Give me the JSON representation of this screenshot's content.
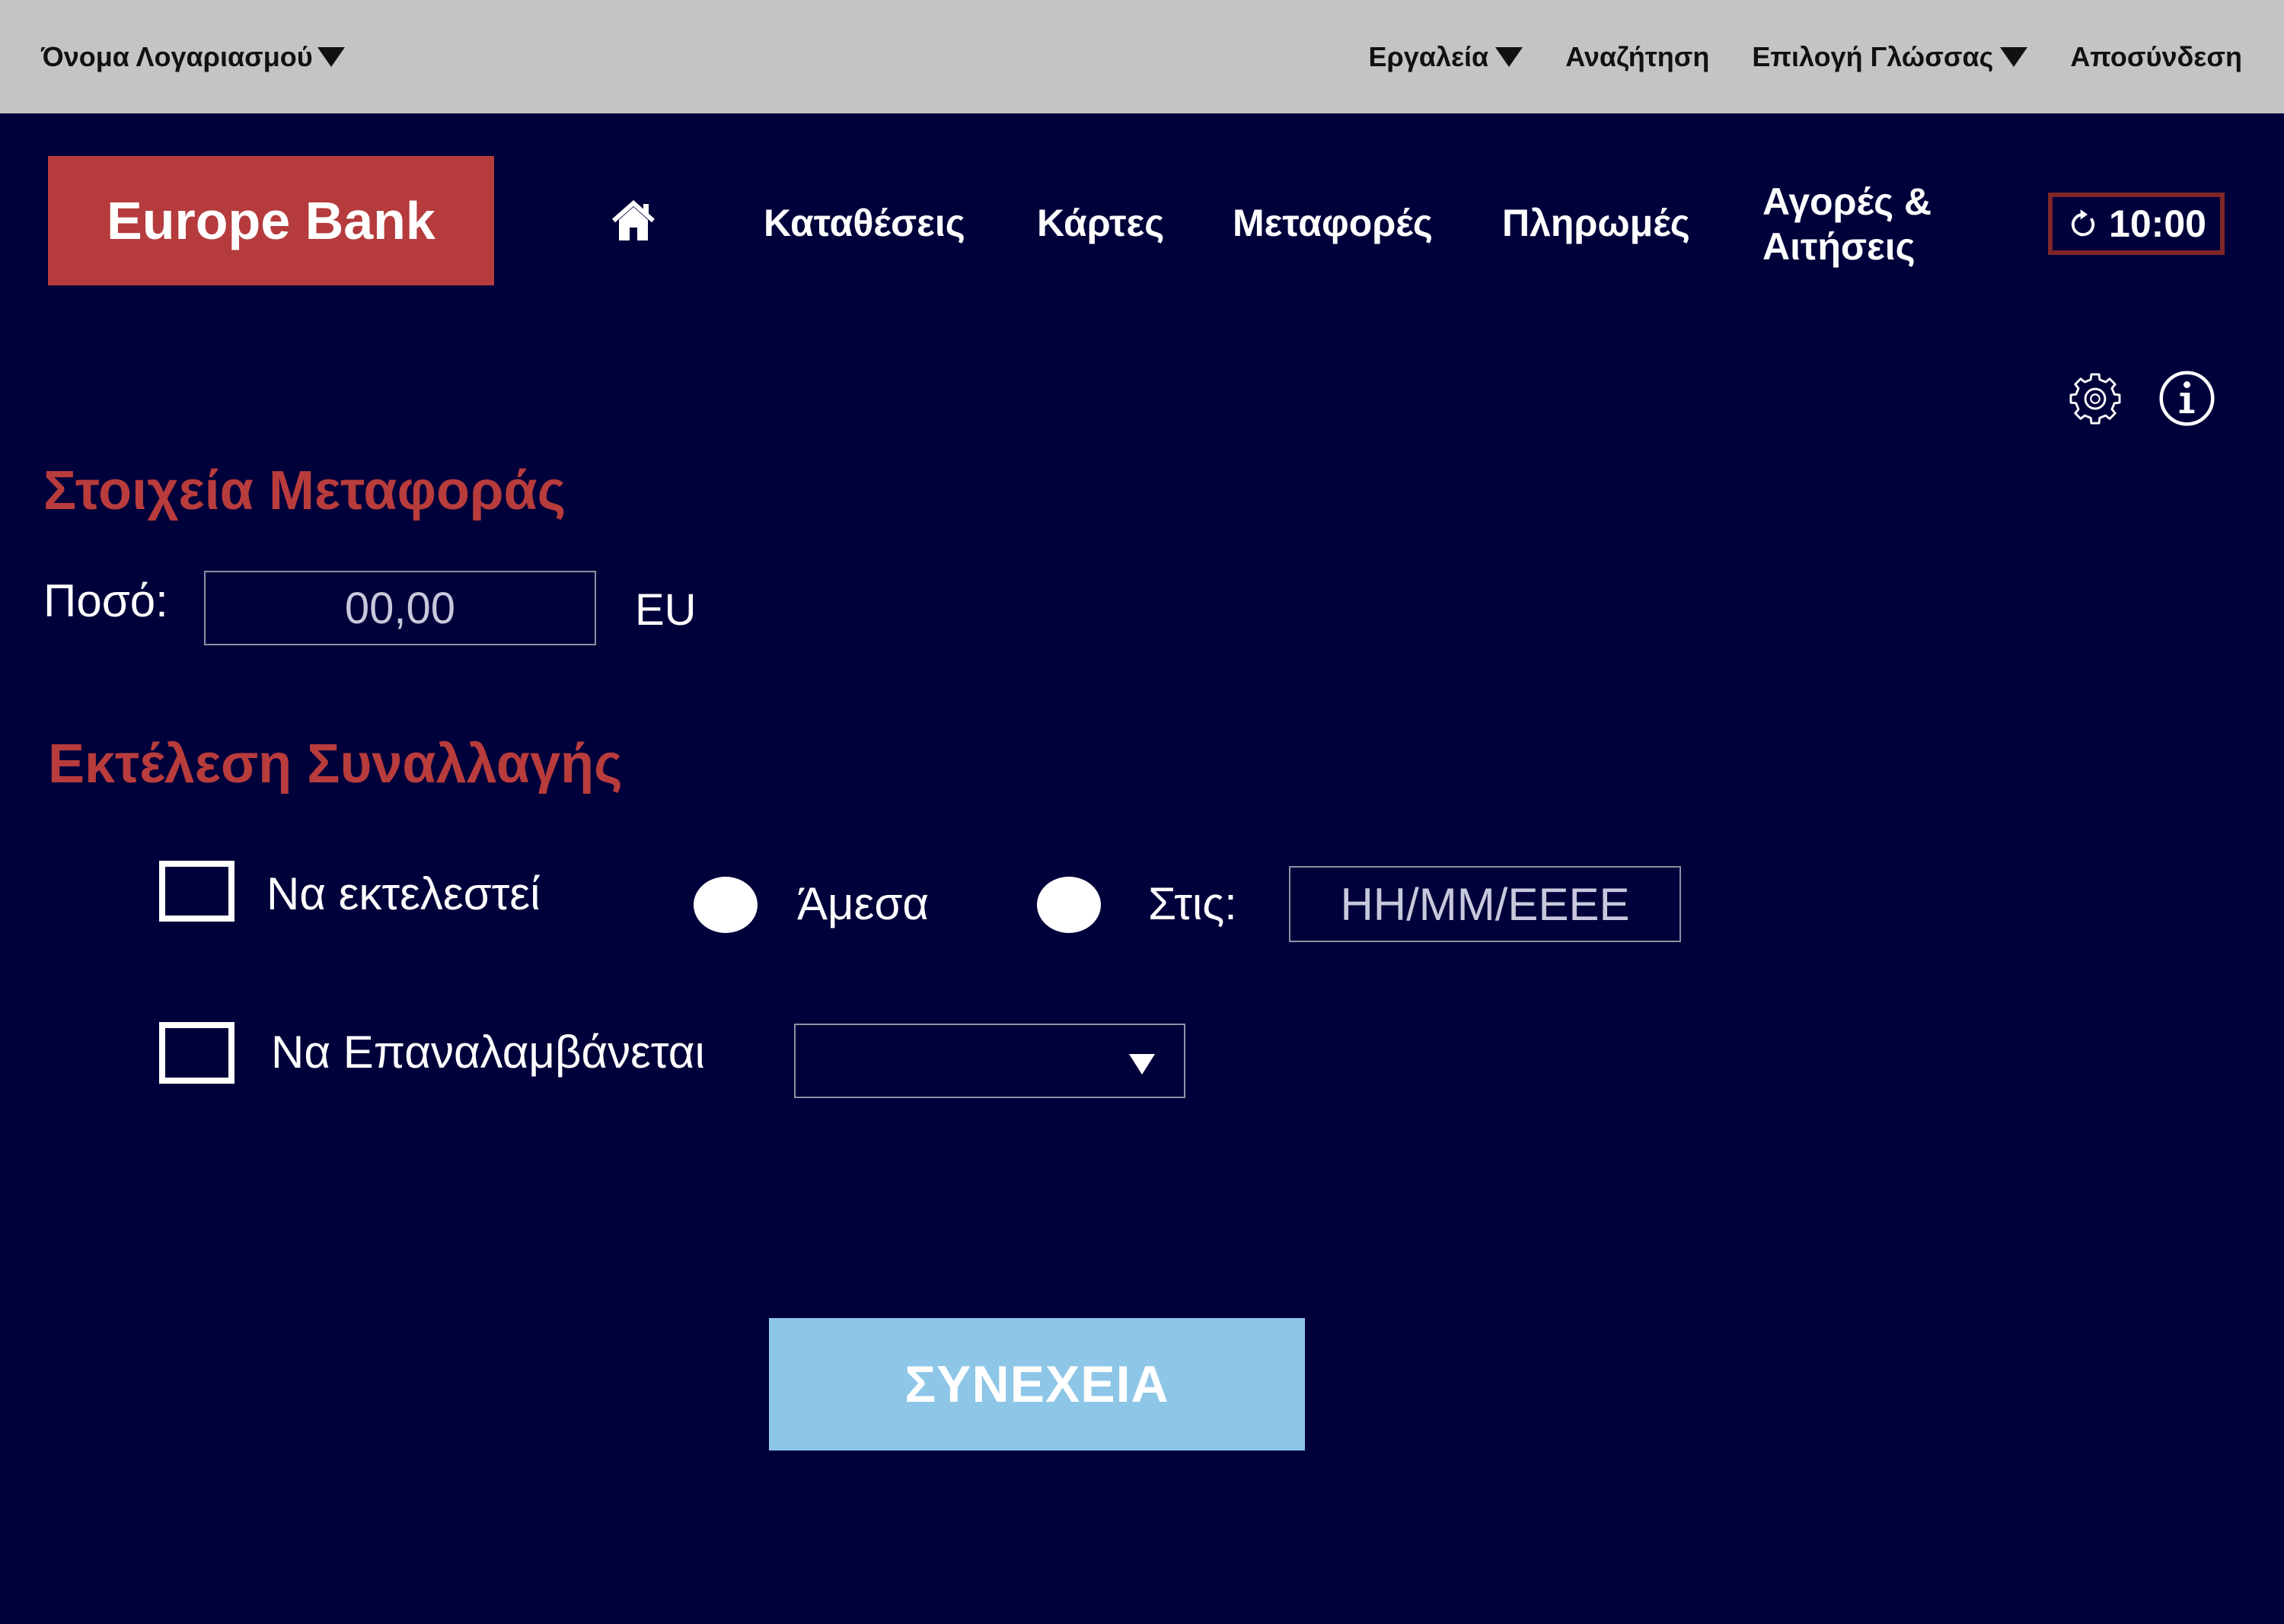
{
  "top_bar": {
    "account_label": "Όνομα Λογαριασμού",
    "tools_label": "Εργαλεία",
    "search_label": "Αναζήτηση",
    "language_label": "Επιλογή Γλώσσας",
    "logout_label": "Αποσύνδεση"
  },
  "header": {
    "logo_text": "Europe Bank",
    "nav": [
      {
        "label": "Καταθέσεις"
      },
      {
        "label": "Κάρτες"
      },
      {
        "label": "Μεταφορές"
      },
      {
        "label": "Πληρωμές"
      },
      {
        "label": "Αγορές & Αιτήσεις"
      }
    ],
    "session_timer": "10:00"
  },
  "transfer": {
    "heading": "Στοιχεία Μεταφοράς",
    "amount_label": "Ποσό:",
    "amount_placeholder": "00,00",
    "currency": "EU"
  },
  "execution": {
    "heading": "Εκτέλεση Συναλλαγής",
    "execute_label": "Να εκτελεστεί",
    "immediate_label": "Άμεσα",
    "scheduled_label": "Στις:",
    "date_placeholder": "HH/MM/EEEE",
    "repeat_label": "Να Επαναλαμβάνεται"
  },
  "actions": {
    "continue_label": "ΣΥΝΕΧΕΙΑ"
  },
  "icons": {
    "account_menu": "caret-down-icon",
    "tools_menu": "caret-down-icon",
    "language_menu": "caret-down-icon",
    "home": "home-icon",
    "timer": "refresh-icon",
    "settings": "gear-icon",
    "info": "info-icon",
    "repeat_select": "caret-down-icon"
  },
  "colors": {
    "background": "#00003a",
    "top_bar": "#c4c4c4",
    "brand": "#b53b3d",
    "accent": "#b83c3c",
    "timer_border": "#7e2628",
    "button": "#8ec6e8",
    "field_border": "#9090a4",
    "placeholder": "#c8c8dc"
  }
}
